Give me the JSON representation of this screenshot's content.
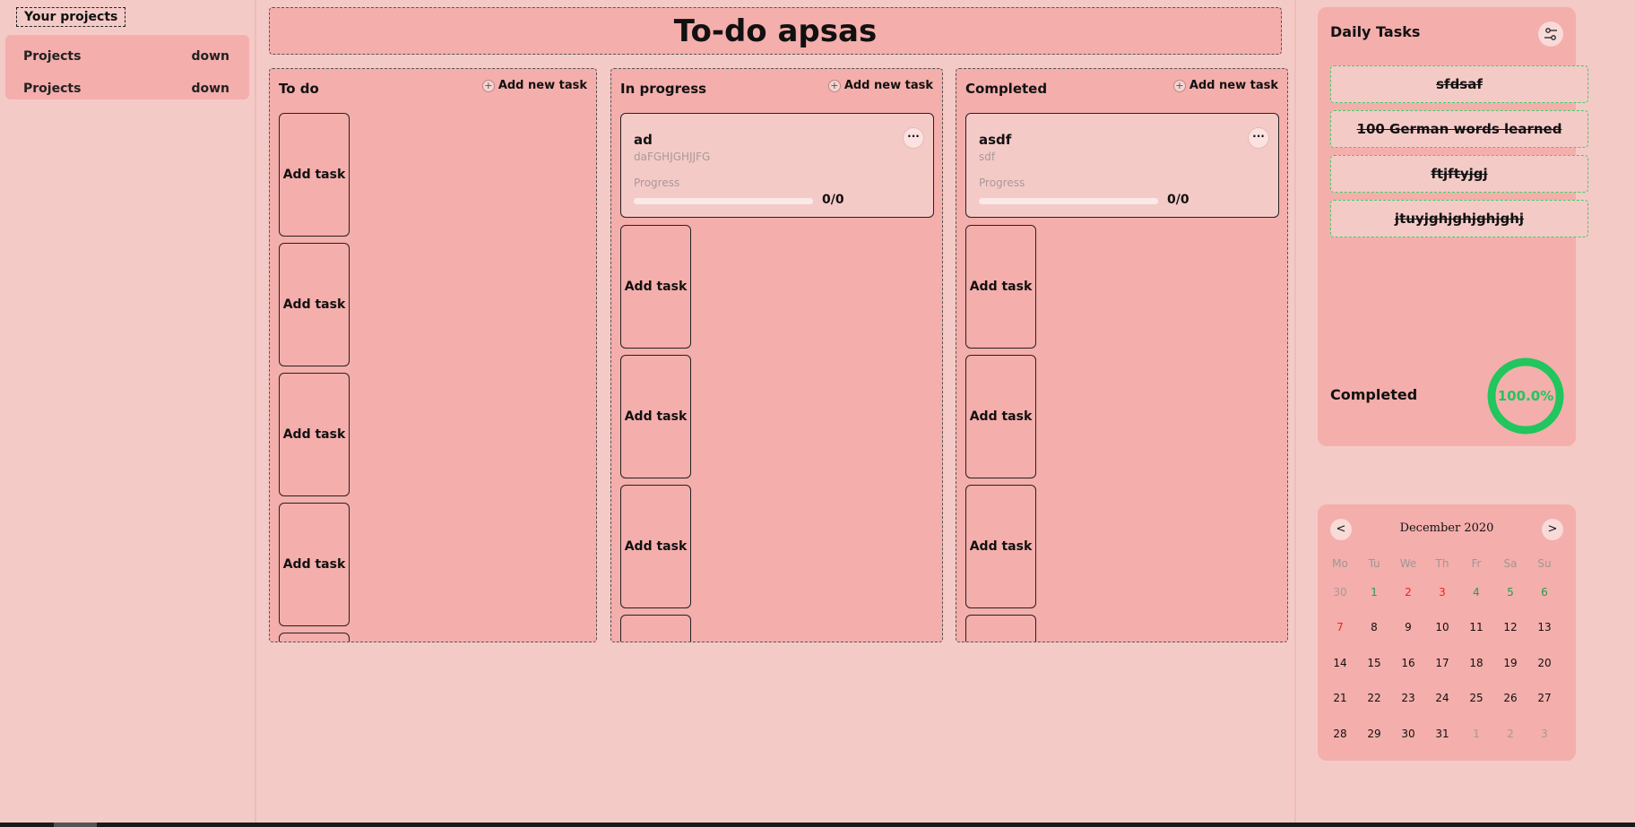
{
  "sidebar": {
    "title": "Your projects",
    "projects": [
      {
        "label": "Projects",
        "toggle": "down"
      },
      {
        "label": "Projects",
        "toggle": "down"
      }
    ]
  },
  "board": {
    "title": "To-do apsas",
    "add_new_label": "Add new task",
    "add_task_label": "Add task",
    "columns": [
      {
        "title": "To do"
      },
      {
        "title": "In progress",
        "task": {
          "title": "ad",
          "description": "daFGHJGHJJFG",
          "progress_label": "Progress",
          "progress": "0/0"
        }
      },
      {
        "title": "Completed",
        "task": {
          "title": "asdf",
          "description": "sdf",
          "progress_label": "Progress",
          "progress": "0/0"
        }
      }
    ]
  },
  "daily": {
    "title": "Daily Tasks",
    "items": [
      "sfdsaf",
      "100 German words learned",
      "ftjftyjgj",
      "jtuyjghjghjghjghj"
    ],
    "completed_label": "Completed",
    "completed_percent": "100.0%",
    "completed_fraction": 1.0,
    "ring_color": "#22c55e"
  },
  "calendar": {
    "prev": "<",
    "next": ">",
    "month": "December 2020",
    "weekdays": [
      "Mo",
      "Tu",
      "We",
      "Th",
      "Fr",
      "Sa",
      "Su"
    ],
    "weeks": [
      [
        "30",
        "1",
        "2",
        "3",
        "4",
        "5",
        "6"
      ],
      [
        "7",
        "8",
        "9",
        "10",
        "11",
        "12",
        "13"
      ],
      [
        "14",
        "15",
        "16",
        "17",
        "18",
        "19",
        "20"
      ],
      [
        "21",
        "22",
        "23",
        "24",
        "25",
        "26",
        "27"
      ],
      [
        "28",
        "29",
        "30",
        "31",
        "1",
        "2",
        "3"
      ]
    ]
  }
}
